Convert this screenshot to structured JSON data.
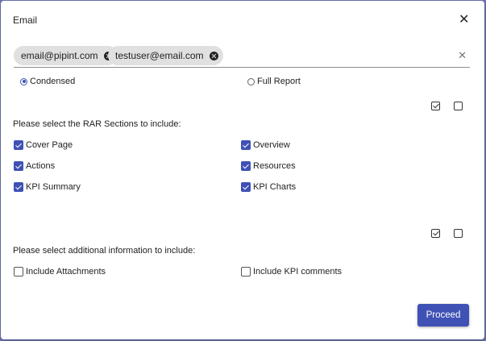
{
  "dialog": {
    "title": "Email",
    "close_icon": "close-icon"
  },
  "recipients": {
    "chips": [
      "email@pipint.com",
      "testuser@email.com"
    ],
    "clear_icon": "clear-icon"
  },
  "report_type": {
    "options": [
      {
        "label": "Condensed",
        "selected": true
      },
      {
        "label": "Full Report",
        "selected": false
      }
    ]
  },
  "rar_sections": {
    "select_all_checked": true,
    "select_none_checked": false,
    "heading": "Please select the RAR Sections to include:",
    "items": [
      {
        "label": "Cover Page",
        "checked": true
      },
      {
        "label": "Overview",
        "checked": true
      },
      {
        "label": "Actions",
        "checked": true
      },
      {
        "label": "Resources",
        "checked": true
      },
      {
        "label": "KPI Summary",
        "checked": true
      },
      {
        "label": "KPI Charts",
        "checked": true
      }
    ]
  },
  "additional_info": {
    "select_all_checked": true,
    "select_none_checked": false,
    "heading": "Please select additional information to include:",
    "items": [
      {
        "label": "Include Attachments",
        "checked": false
      },
      {
        "label": "Include KPI comments",
        "checked": false
      }
    ]
  },
  "actions": {
    "proceed_label": "Proceed"
  },
  "colors": {
    "accent": "#3f51b5",
    "chip_bg": "#e0e0e0"
  }
}
